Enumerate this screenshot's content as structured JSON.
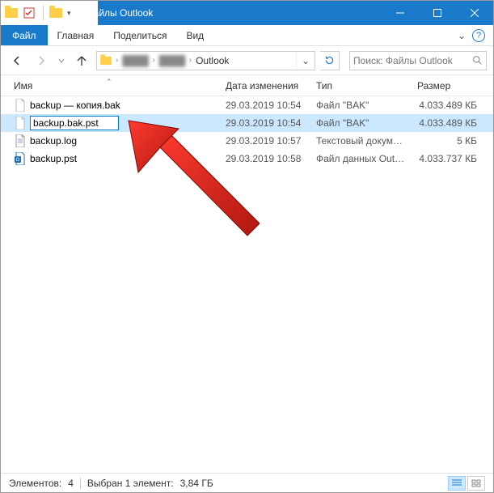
{
  "window": {
    "title": "Файлы Outlook"
  },
  "ribbon": {
    "file": "Файл",
    "tabs": [
      "Главная",
      "Поделиться",
      "Вид"
    ]
  },
  "address": {
    "hidden1": "████",
    "hidden2": "████",
    "current": "Outlook"
  },
  "search": {
    "placeholder": "Поиск: Файлы Outlook"
  },
  "columns": {
    "name": "Имя",
    "date": "Дата изменения",
    "type": "Тип",
    "size": "Размер"
  },
  "files": [
    {
      "name": "backup — копия.bak",
      "date": "29.03.2019 10:54",
      "type": "Файл \"BAK\"",
      "size": "4.033.489 КБ",
      "icon": "blank"
    },
    {
      "name": "backup.bak.pst",
      "date": "29.03.2019 10:54",
      "type": "Файл \"BAK\"",
      "size": "4.033.489 КБ",
      "icon": "blank",
      "renaming": true,
      "selected": true
    },
    {
      "name": "backup.log",
      "date": "29.03.2019 10:57",
      "type": "Текстовый докум…",
      "size": "5 КБ",
      "icon": "text"
    },
    {
      "name": "backup.pst",
      "date": "29.03.2019 10:58",
      "type": "Файл данных Out…",
      "size": "4.033.737 КБ",
      "icon": "pst"
    }
  ],
  "status": {
    "count_label": "Элементов:",
    "count": "4",
    "selected_label": "Выбран 1 элемент:",
    "selected_size": "3,84 ГБ"
  }
}
